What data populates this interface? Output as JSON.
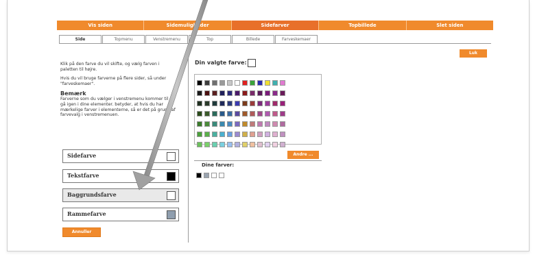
{
  "topnav": [
    "Vis siden",
    "Sidemuligheder",
    "Sidefarver",
    "Topbillede",
    "Slet siden"
  ],
  "active_nav_index": 2,
  "tabs": [
    "Side",
    "Topmenu",
    "Venstremenu",
    "Top",
    "Billede",
    "Farveskemaer"
  ],
  "active_tab_index": 0,
  "close_label": "Luk",
  "intro_text_1": "Klik på den farve du vil skifte, og vælg farven i paletten til højre.",
  "intro_text_2": "Hvis du vil bruge farverne på flere sider, så under \"farveskemaer\".",
  "note_title": "Bemærk",
  "note_text": "Farverne som du vælger i venstremenu kommer til at gå igen i dine elementer. betyder, at hvis du har mærkelige farver i elementerne, så er det på grund af farvevalg i venstremenuen.",
  "color_items": [
    {
      "label": "Sidefarve",
      "color": "#ffffff"
    },
    {
      "label": "Tekstfarve",
      "color": "#000000"
    },
    {
      "label": "Baggrundsfarve",
      "color": "#ffffff"
    },
    {
      "label": "Rammefarve",
      "color": "#8f9eae"
    }
  ],
  "highlighted_item_index": 2,
  "cancel_label": "Annuller",
  "chosen_color_label": "Din valgte farve:",
  "chosen_color_value": "#ffffff",
  "palette": [
    [
      "#000000",
      "#3c3c3c",
      "#6e6e6e",
      "#9a9a9a",
      "#c7c7c7",
      "#ffffff",
      "#e02020",
      "#3aa33a",
      "#2b2bb0",
      "#f0e030",
      "#40b0b0",
      "#e07ad0"
    ],
    [
      "#1a1a1a",
      "#4a1010",
      "#5a1f1f",
      "#1f1f5a",
      "#2a2a7a",
      "#4a1a6a",
      "#8a1a1a",
      "#7a2a6a",
      "#5a1a5a",
      "#7a1a7a",
      "#8a2a8a",
      "#6a1a5a"
    ],
    [
      "#1f2f1f",
      "#2a3a2a",
      "#1f3a3a",
      "#1f2a5a",
      "#2a3a7a",
      "#3a3ab0",
      "#7a3a1a",
      "#9a3a3a",
      "#7a2a7a",
      "#9a3a9a",
      "#a02a6a",
      "#9a1f7a"
    ],
    [
      "#2a4a1a",
      "#3a5a2a",
      "#2a6a5a",
      "#2a5a8a",
      "#3a6aa0",
      "#5a4aa0",
      "#a05a2a",
      "#b05a5a",
      "#a04a8a",
      "#b05ab0",
      "#c05a8a",
      "#a03a8a"
    ],
    [
      "#3a7a2a",
      "#4a8a3a",
      "#3a8a7a",
      "#3a8ab0",
      "#4a8ac0",
      "#7a6ac0",
      "#c08a2a",
      "#c07a7a",
      "#c07ab0",
      "#c08ac0",
      "#d08ab0",
      "#b06aa0"
    ],
    [
      "#4aa03a",
      "#5ab04a",
      "#4ab0a0",
      "#4ab0d0",
      "#6aa0e0",
      "#9a8ad0",
      "#d0b04a",
      "#e0a090",
      "#d0a0c0",
      "#d0b0e0",
      "#e0b0d0",
      "#c090c0"
    ],
    [
      "#6ac05a",
      "#7ad06a",
      "#6ad0b0",
      "#7ad0e0",
      "#9ac0f0",
      "#b0b0e0",
      "#e0d06a",
      "#f0c0a0",
      "#e0c0d0",
      "#e0d0f0",
      "#f0d0e0",
      "#d0b0d0"
    ]
  ],
  "other_label": "Andre ...",
  "my_colors_label": "Dine farver:",
  "my_colors": [
    "#000000",
    "#9aa4b0",
    "#ffffff",
    "#ffffff"
  ],
  "accent_color": "#f08a2c"
}
